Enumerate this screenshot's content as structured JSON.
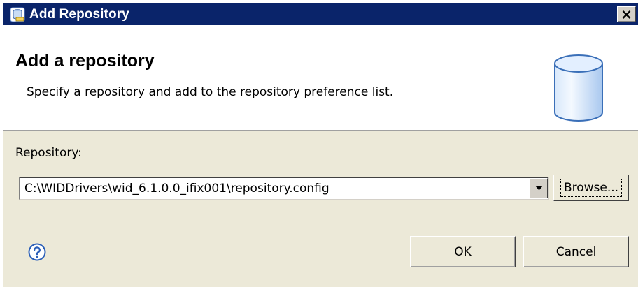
{
  "window": {
    "title": "Add Repository",
    "title_icon": "repository-app-icon",
    "close_label": "×"
  },
  "header": {
    "title": "Add a repository",
    "description": "Specify a repository and add to the repository preference list.",
    "icon": "database-cylinder-icon"
  },
  "form": {
    "repository_label": "Repository:",
    "repository_value": "C:\\WIDDrivers\\wid_6.1.0.0_ifix001\\repository.config",
    "browse_label": "Browse..."
  },
  "footer": {
    "help_icon": "help-question-icon",
    "ok_label": "OK",
    "cancel_label": "Cancel"
  },
  "colors": {
    "titlebar": "#0a246a",
    "dialog_bg": "#ece9d8",
    "header_bg": "#ffffff",
    "help_blue": "#2b5fb8"
  }
}
